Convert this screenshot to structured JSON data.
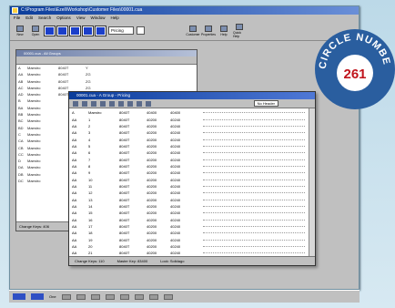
{
  "window": {
    "title": "C:\\Program Files\\Ezell\\Workshop\\Customer Files\\00001.cua"
  },
  "menu": [
    "File",
    "Edit",
    "Search",
    "Options",
    "View",
    "Window",
    "Help"
  ],
  "toolbar": {
    "left_buttons": [
      "New",
      "Open"
    ],
    "combo_value": "Pricing",
    "right_buttons": [
      "Customer",
      "Properties",
      "Help",
      "Quick Help"
    ]
  },
  "window1": {
    "title": "00001.cua - All Groups",
    "rows": [
      {
        "a": "A",
        "b": "Maestro",
        "c": "8040T",
        "d": "Y"
      },
      {
        "a": "AA",
        "b": "Maestro",
        "c": "8040T",
        "d": "ZG"
      },
      {
        "a": "AB",
        "b": "Maestro",
        "c": "8040T",
        "d": "ZG"
      },
      {
        "a": "AC",
        "b": "Maestro",
        "c": "8040T",
        "d": "ZG"
      },
      {
        "a": "AD",
        "b": "Maestro",
        "c": "8040T",
        "d": ""
      },
      {
        "a": "B",
        "b": "Maestro",
        "c": "",
        "d": ""
      },
      {
        "a": "BA",
        "b": "Maestro",
        "c": "",
        "d": ""
      },
      {
        "a": "BB",
        "b": "Maestro",
        "c": "",
        "d": ""
      },
      {
        "a": "BC",
        "b": "Maestro",
        "c": "",
        "d": ""
      },
      {
        "a": "BD",
        "b": "Maestro",
        "c": "",
        "d": ""
      },
      {
        "a": "C",
        "b": "Maestro",
        "c": "",
        "d": ""
      },
      {
        "a": "CA",
        "b": "Maestro",
        "c": "",
        "d": ""
      },
      {
        "a": "CB",
        "b": "Maestro",
        "c": "",
        "d": ""
      },
      {
        "a": "CC",
        "b": "Maestro",
        "c": "",
        "d": ""
      },
      {
        "a": "D",
        "b": "Maestro",
        "c": "",
        "d": ""
      },
      {
        "a": "DA",
        "b": "Maestro",
        "c": "",
        "d": ""
      },
      {
        "a": "DB",
        "b": "Maestro",
        "c": "",
        "d": ""
      },
      {
        "a": "DC",
        "b": "Maestro",
        "c": "",
        "d": ""
      }
    ],
    "status": "Change Keys: 406"
  },
  "window2": {
    "title": "00001.cua - A Group - Pricing",
    "no_header": "No Header",
    "rows": [
      {
        "a": "A",
        "b": "Maestro",
        "c": "8040T",
        "d": "40400",
        "e": "40400"
      },
      {
        "a": "AA",
        "b": "1",
        "c": "8040T",
        "d": "40200",
        "e": "40240"
      },
      {
        "a": "AA",
        "b": "2",
        "c": "8040T",
        "d": "40200",
        "e": "40240"
      },
      {
        "a": "AA",
        "b": "3",
        "c": "8040T",
        "d": "40200",
        "e": "40240"
      },
      {
        "a": "AA",
        "b": "4",
        "c": "8040T",
        "d": "40200",
        "e": "40240"
      },
      {
        "a": "AA",
        "b": "5",
        "c": "8040T",
        "d": "40200",
        "e": "40240"
      },
      {
        "a": "AA",
        "b": "6",
        "c": "8040T",
        "d": "40200",
        "e": "40240"
      },
      {
        "a": "AA",
        "b": "7",
        "c": "8040T",
        "d": "40200",
        "e": "40240"
      },
      {
        "a": "AA",
        "b": "8",
        "c": "8040T",
        "d": "40200",
        "e": "40240"
      },
      {
        "a": "AA",
        "b": "9",
        "c": "8040T",
        "d": "40200",
        "e": "40240"
      },
      {
        "a": "AA",
        "b": "10",
        "c": "8040T",
        "d": "40200",
        "e": "40240"
      },
      {
        "a": "AA",
        "b": "11",
        "c": "8040T",
        "d": "40200",
        "e": "40240"
      },
      {
        "a": "AA",
        "b": "12",
        "c": "8040T",
        "d": "40200",
        "e": "40240"
      },
      {
        "a": "AA",
        "b": "13",
        "c": "8040T",
        "d": "40200",
        "e": "40240"
      },
      {
        "a": "AA",
        "b": "14",
        "c": "8040T",
        "d": "40200",
        "e": "40240"
      },
      {
        "a": "AA",
        "b": "15",
        "c": "8040T",
        "d": "40200",
        "e": "40240"
      },
      {
        "a": "AA",
        "b": "16",
        "c": "8040T",
        "d": "40200",
        "e": "40240"
      },
      {
        "a": "AA",
        "b": "17",
        "c": "8040T",
        "d": "40200",
        "e": "40240"
      },
      {
        "a": "AA",
        "b": "18",
        "c": "8040T",
        "d": "40200",
        "e": "40240"
      },
      {
        "a": "AA",
        "b": "19",
        "c": "8040T",
        "d": "40200",
        "e": "40240"
      },
      {
        "a": "AA",
        "b": "20",
        "c": "8040T",
        "d": "40200",
        "e": "40240"
      },
      {
        "a": "AA",
        "b": "21",
        "c": "8040T",
        "d": "40200",
        "e": "40240"
      }
    ],
    "status": [
      "Change Keys: 110",
      "Master Key: 83400",
      "Lock: Solidago"
    ]
  },
  "badge": {
    "text": "CIRCLE NUMBER",
    "number": "261",
    "color": "#2a5e9f"
  },
  "taskbar": {
    "label": "One"
  }
}
